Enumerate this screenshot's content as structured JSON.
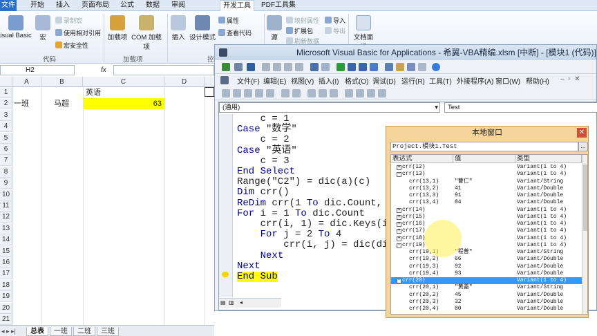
{
  "menubar": {
    "tabs": [
      "文件",
      "开始",
      "插入",
      "页面布局",
      "公式",
      "数据",
      "审阅",
      "开发工具",
      "PDF工具集"
    ],
    "active_index": 7
  },
  "ribbon": {
    "visual_basic": "isual Basic",
    "macro": "宏",
    "record_macro": "录制宏",
    "relative_ref": "使用相对引用",
    "macro_security": "宏安全性",
    "group_code": "代码",
    "addins": "加载项",
    "com_addins": "COM 加载项",
    "group_addins": "加载项",
    "insert": "插入",
    "design_mode": "设计模式",
    "properties": "属性",
    "view_code": "查看代码",
    "group_controls": "控",
    "source": "源",
    "map_props": "映射属性",
    "expansion_pack": "扩展包",
    "refresh_data": "刷新数据",
    "import": "导入",
    "export": "导出",
    "doc_panel": "文档面板"
  },
  "excel": {
    "name_box": "H2",
    "fx": "fx",
    "columns": [
      "A",
      "B",
      "C",
      "D"
    ],
    "rows": [
      "1",
      "2",
      "3",
      "4",
      "5",
      "6",
      "7",
      "8",
      "9",
      "10",
      "11",
      "12",
      "13",
      "14",
      "15",
      "16",
      "17",
      "18",
      "19",
      "20",
      "21"
    ],
    "cells": {
      "c1": "英语",
      "a2": "一班",
      "b2": "马超",
      "c2": "63"
    },
    "sheet_tabs": [
      "总表",
      "一班",
      "二班",
      "三班"
    ]
  },
  "vbe": {
    "title": "Microsoft Visual Basic for Applications - 希翼-VBA精编.xlsm [中断] - [模块1 (代码)]",
    "menu": [
      "文件(F)",
      "编辑(E)",
      "视图(V)",
      "插入(I)",
      "格式(O)",
      "调试(D)",
      "运行(R)",
      "工具(T)",
      "外接程序(A)",
      "窗口(W)",
      "帮助(H)"
    ],
    "object_box": "(通用)",
    "proc_box": "Test",
    "code_lines": [
      "    c = 1",
      "Case \"数学\"",
      "    c = 2",
      "Case \"英语\"",
      "    c = 3",
      "End Select",
      "Range(\"C2\") = dic(a)(c)",
      "Dim crr()",
      "ReDim crr(1 To dic.Count, 1",
      "For i = 1 To dic.Count",
      "    crr(i, 1) = dic.Keys(i -",
      "    For j = 2 To 4",
      "        crr(i, j) = dic(dic.",
      "    Next",
      "Next",
      "End Sub"
    ]
  },
  "locals": {
    "title": "本地窗口",
    "context": "Project.模块1.Test",
    "context_button": "...",
    "headers": [
      "表达式",
      "值",
      "类型"
    ],
    "rows": [
      {
        "expr": "crr(12)",
        "value": "",
        "type": "Variant(1 to 4)",
        "indent": 0,
        "toggle": "+"
      },
      {
        "expr": "crr(13)",
        "value": "",
        "type": "Variant(1 to 4)",
        "indent": 0,
        "toggle": "-"
      },
      {
        "expr": "crr(13,1)",
        "value": "\"曹仁\"",
        "type": "Variant/String",
        "indent": 1,
        "toggle": ""
      },
      {
        "expr": "crr(13,2)",
        "value": "41",
        "type": "Variant/Double",
        "indent": 1,
        "toggle": ""
      },
      {
        "expr": "crr(13,3)",
        "value": "91",
        "type": "Variant/Double",
        "indent": 1,
        "toggle": ""
      },
      {
        "expr": "crr(13,4)",
        "value": "84",
        "type": "Variant/Double",
        "indent": 1,
        "toggle": ""
      },
      {
        "expr": "crr(14)",
        "value": "",
        "type": "Variant(1 to 4)",
        "indent": 0,
        "toggle": "+"
      },
      {
        "expr": "crr(15)",
        "value": "",
        "type": "Variant(1 to 4)",
        "indent": 0,
        "toggle": "+"
      },
      {
        "expr": "crr(16)",
        "value": "",
        "type": "Variant(1 to 4)",
        "indent": 0,
        "toggle": "+"
      },
      {
        "expr": "crr(17)",
        "value": "",
        "type": "Variant(1 to 4)",
        "indent": 0,
        "toggle": "+"
      },
      {
        "expr": "crr(18)",
        "value": "",
        "type": "Variant(1 to 4)",
        "indent": 0,
        "toggle": "+"
      },
      {
        "expr": "crr(19)",
        "value": "",
        "type": "Variant(1 to 4)",
        "indent": 0,
        "toggle": "-"
      },
      {
        "expr": "crr(19,1)",
        "value": "\"程普\"",
        "type": "Variant/String",
        "indent": 1,
        "toggle": ""
      },
      {
        "expr": "crr(19,2)",
        "value": "66",
        "type": "Variant/Double",
        "indent": 1,
        "toggle": ""
      },
      {
        "expr": "crr(19,3)",
        "value": "92",
        "type": "Variant/Double",
        "indent": 1,
        "toggle": ""
      },
      {
        "expr": "crr(19,4)",
        "value": "93",
        "type": "Variant/Double",
        "indent": 1,
        "toggle": ""
      },
      {
        "expr": "crr(20)",
        "value": "",
        "type": "Variant(1 to 4)",
        "indent": 0,
        "toggle": "-",
        "selected": true
      },
      {
        "expr": "crr(20,1)",
        "value": "\"黄盖\"",
        "type": "Variant/String",
        "indent": 1,
        "toggle": ""
      },
      {
        "expr": "crr(20,2)",
        "value": "45",
        "type": "Variant/Double",
        "indent": 1,
        "toggle": ""
      },
      {
        "expr": "crr(20,3)",
        "value": "32",
        "type": "Variant/Double",
        "indent": 1,
        "toggle": ""
      },
      {
        "expr": "crr(20,4)",
        "value": "80",
        "type": "Variant/Double",
        "indent": 1,
        "toggle": ""
      }
    ]
  },
  "colors": {
    "highlight_cell": "#ffff00",
    "keyword": "#00008b",
    "locals_bg": "#f4d49a",
    "selected_row": "#3399ff",
    "execution_point": "#ffff00"
  }
}
